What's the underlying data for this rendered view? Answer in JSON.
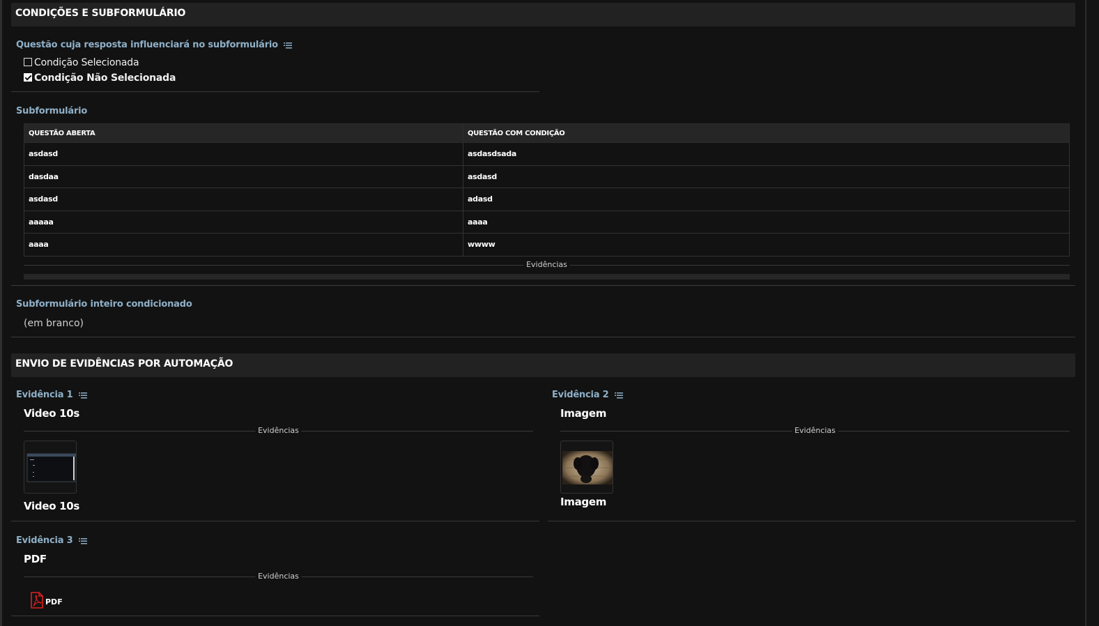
{
  "section1": {
    "title": "CONDIÇÕES E SUBFORMULÁRIO",
    "question_label": "Questão cuja resposta influenciará no subformulário",
    "options": [
      {
        "label": "Condição Selecionada",
        "checked": false
      },
      {
        "label": "Condição Não Selecionada",
        "checked": true
      }
    ],
    "subform_label": "Subformulário",
    "table": {
      "headers": [
        "QUESTÃO ABERTA",
        "QUESTÃO COM CONDIÇÃO"
      ],
      "rows": [
        [
          "asdasd",
          "asdasdsada"
        ],
        [
          "dasdaa",
          "asdasd"
        ],
        [
          "asdasd",
          "adasd"
        ],
        [
          "aaaaa",
          "aaaa"
        ],
        [
          "aaaa",
          "wwww"
        ]
      ]
    },
    "evidence_divider": "Evidências",
    "whole_label": "Subformulário inteiro condicionado",
    "whole_value": "(em branco)"
  },
  "section2": {
    "title": "ENVIO DE EVIDÊNCIAS POR AUTOMAÇÃO",
    "evidences": [
      {
        "label": "Evidência 1",
        "value": "Video 10s",
        "divider": "Evidências",
        "thumb_kind": "video-screenshot",
        "caption": "Video 10s"
      },
      {
        "label": "Evidência 2",
        "value": "Imagem",
        "divider": "Evidências",
        "thumb_kind": "dog-photo",
        "caption": "Imagem"
      },
      {
        "label": "Evidência 3",
        "value": "PDF",
        "divider": "Evidências",
        "thumb_kind": "pdf-icon",
        "caption": "PDF"
      }
    ]
  },
  "colors": {
    "background": "#121212",
    "header_bg": "#222222",
    "label_blue": "#8fb0c8",
    "pdf_red": "#e02020"
  },
  "icons": [
    "list-icon",
    "checkbox-icon",
    "pdf-icon"
  ]
}
